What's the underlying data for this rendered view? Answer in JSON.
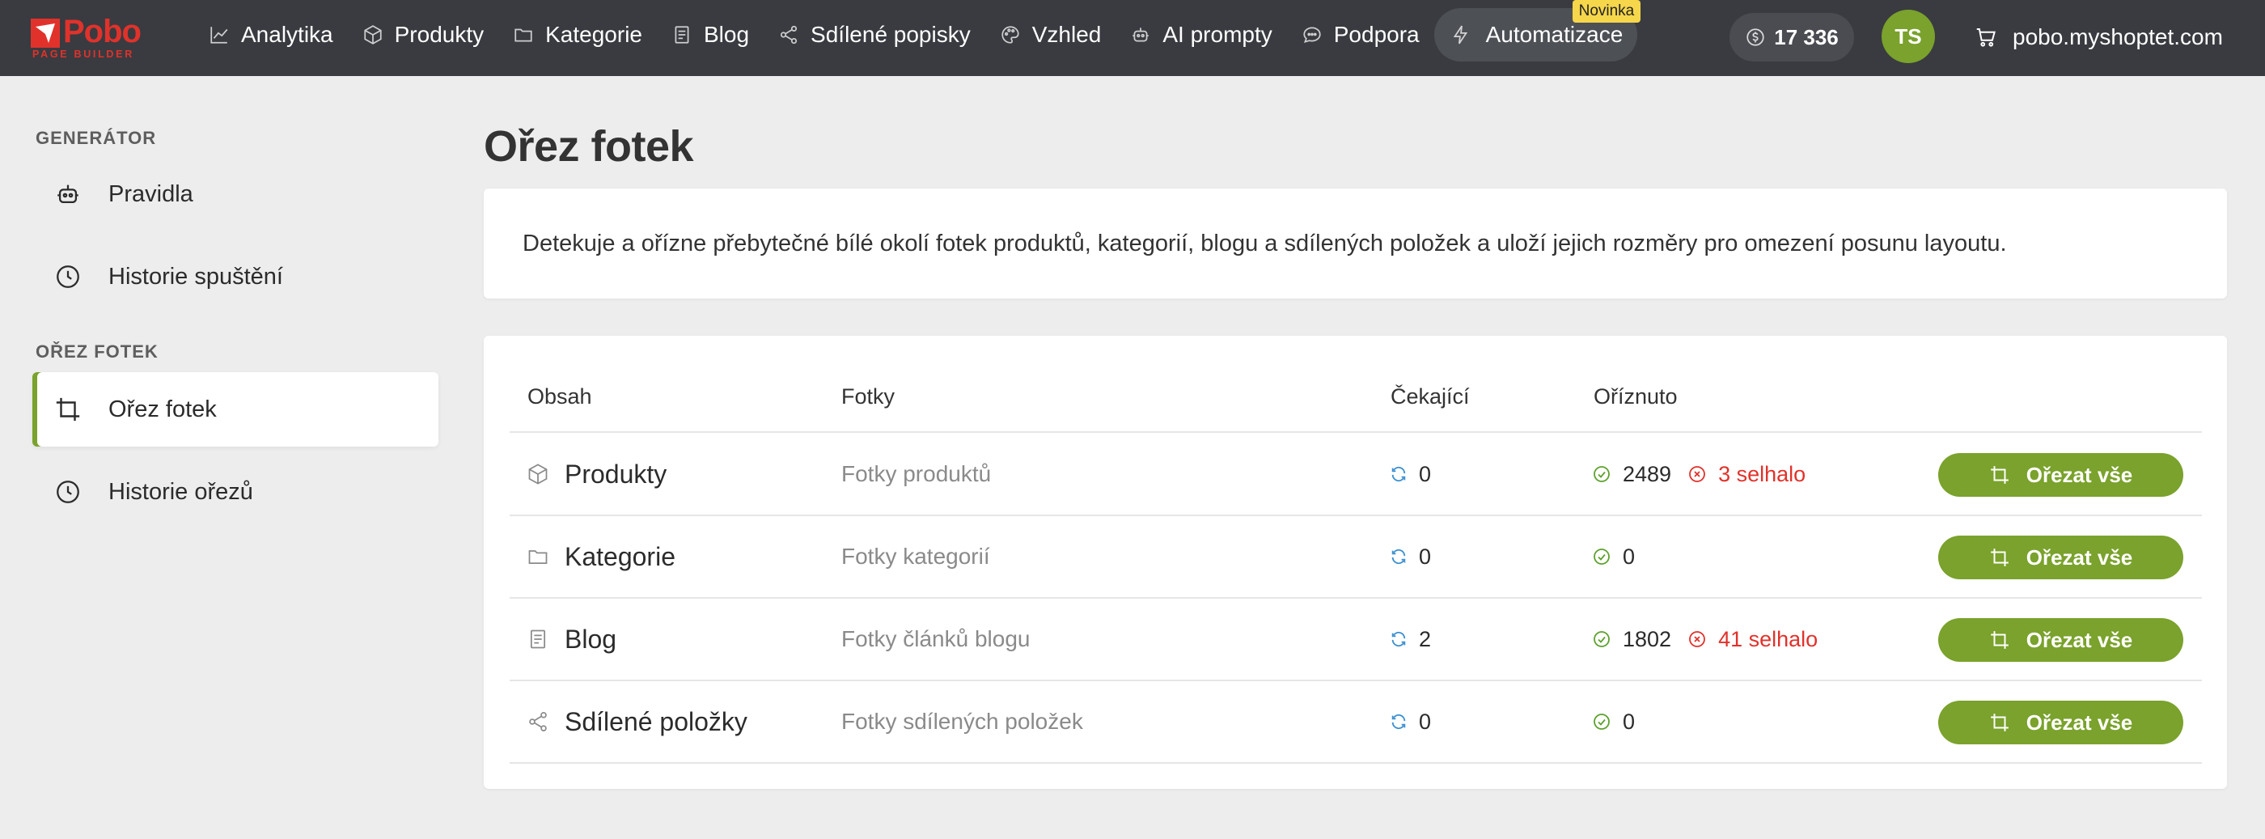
{
  "brand": {
    "name": "Pobo",
    "subtitle": "PAGE BUILDER",
    "color": "#e0322b"
  },
  "topnav": {
    "items": [
      {
        "label": "Analytika",
        "icon": "chart-line-icon"
      },
      {
        "label": "Produkty",
        "icon": "box-icon"
      },
      {
        "label": "Kategorie",
        "icon": "folder-icon"
      },
      {
        "label": "Blog",
        "icon": "document-icon"
      },
      {
        "label": "Sdílené popisky",
        "icon": "share-icon"
      },
      {
        "label": "Vzhled",
        "icon": "palette-icon"
      },
      {
        "label": "AI prompty",
        "icon": "robot-icon"
      },
      {
        "label": "Podpora",
        "icon": "chat-icon"
      },
      {
        "label": "Automatizace",
        "icon": "lightning-icon",
        "active": true,
        "badge": "Novinka"
      }
    ],
    "credits": "17 336",
    "avatar_initials": "TS",
    "shop": "pobo.myshoptet.com"
  },
  "sidebar": {
    "sections": [
      {
        "title": "GENERÁTOR",
        "items": [
          {
            "label": "Pravidla",
            "icon": "robot-icon"
          },
          {
            "label": "Historie spuštění",
            "icon": "clock-icon"
          }
        ]
      },
      {
        "title": "OŘEZ FOTEK",
        "items": [
          {
            "label": "Ořez fotek",
            "icon": "crop-icon",
            "active": true
          },
          {
            "label": "Historie ořezů",
            "icon": "clock-icon"
          }
        ]
      }
    ]
  },
  "main": {
    "title": "Ořez fotek",
    "description": "Detekuje a ořízne přebytečné bílé okolí fotek produktů, kategorií, blogu a sdílených položek a uloží jejich rozměry pro omezení posunu layoutu.",
    "table": {
      "columns": [
        "Obsah",
        "Fotky",
        "Čekající",
        "Oříznuto"
      ],
      "rows": [
        {
          "name": "Produkty",
          "icon": "box-icon",
          "photos": "Fotky produktů",
          "pending": "0",
          "cropped": "2489",
          "failed": "3 selhalo",
          "action": "Ořezat vše"
        },
        {
          "name": "Kategorie",
          "icon": "folder-icon",
          "photos": "Fotky kategorií",
          "pending": "0",
          "cropped": "0",
          "failed": "",
          "action": "Ořezat vše"
        },
        {
          "name": "Blog",
          "icon": "document-icon",
          "photos": "Fotky článků blogu",
          "pending": "2",
          "cropped": "1802",
          "failed": "41 selhalo",
          "action": "Ořezat vše"
        },
        {
          "name": "Sdílené položky",
          "icon": "share-icon",
          "photos": "Fotky sdílených položek",
          "pending": "0",
          "cropped": "0",
          "failed": "",
          "action": "Ořezat vše"
        }
      ]
    }
  },
  "colors": {
    "accent": "#7aa22c",
    "danger": "#e0322b",
    "topbar": "#393b40",
    "pending": "#3b8fd0",
    "success": "#5ea12f",
    "badge": "#f6d64a"
  }
}
